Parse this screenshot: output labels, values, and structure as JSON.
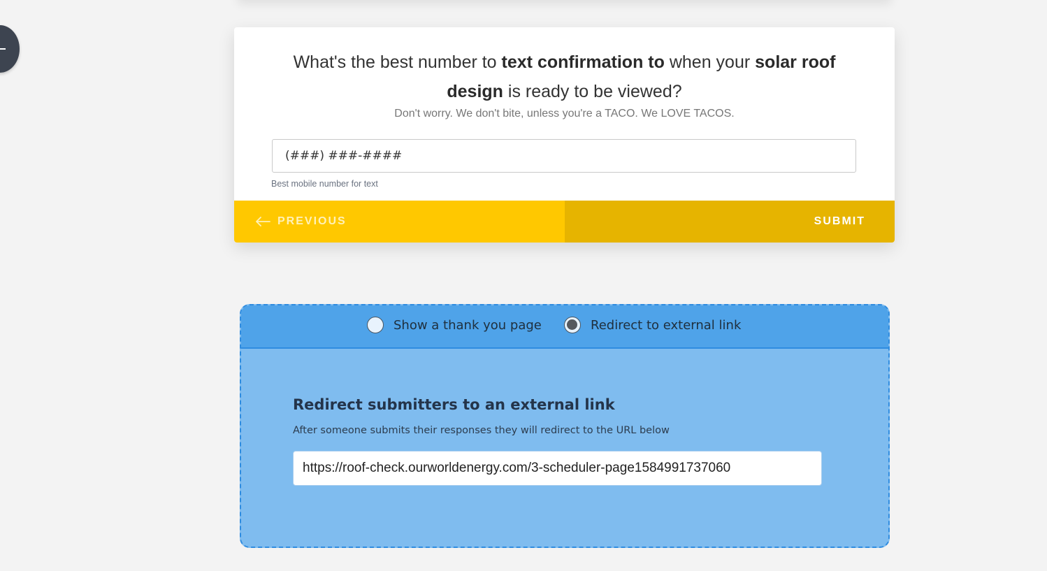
{
  "form": {
    "question_parts": [
      {
        "text": "What's the best number to ",
        "bold": false
      },
      {
        "text": "text confirmation to",
        "bold": true
      },
      {
        "text": " when your ",
        "bold": false
      },
      {
        "text": "solar roof design",
        "bold": true
      },
      {
        "text": " is ready to be viewed?",
        "bold": false
      }
    ],
    "subtext": "Don't worry.  We don't bite, unless you're a TACO.  We LOVE TACOS.",
    "phone_placeholder": "(###) ###-####",
    "phone_helper": "Best mobile number for text",
    "previous_label": "PREVIOUS",
    "submit_label": "SUBMIT"
  },
  "redirect_settings": {
    "options": [
      {
        "label": "Show a thank you page",
        "selected": false
      },
      {
        "label": "Redirect to external link",
        "selected": true
      }
    ],
    "title": "Redirect submitters to an external link",
    "description": "After someone submits their responses they will redirect to the URL below",
    "url_value": "https://roof-check.ourworldenergy.com/3-scheduler-page1584991737060"
  },
  "colors": {
    "previous_button": "#ffc800",
    "submit_button": "#e6b400",
    "panel_header": "#4fa3e9",
    "panel_body": "#7fbcef",
    "panel_border": "#2f8ce0",
    "fab": "#3d4450"
  },
  "icons": {
    "previous": "arrow-left-icon",
    "fab": "plus-icon"
  }
}
